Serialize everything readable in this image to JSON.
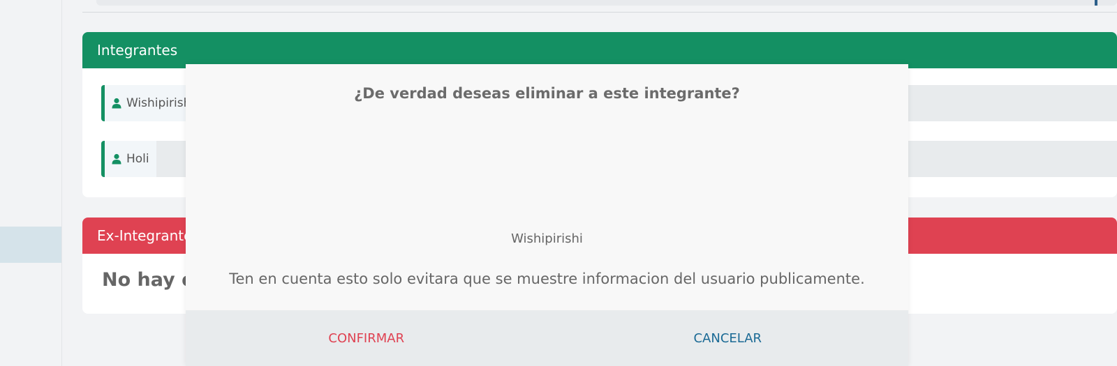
{
  "sections": {
    "integrantes": {
      "title": "Integrantes",
      "members": [
        {
          "name": "Wishipirishi"
        },
        {
          "name": "Holi"
        }
      ]
    },
    "ex_integrantes": {
      "title": "Ex-Integrantes",
      "empty_text": "No hay ex-integrantes"
    }
  },
  "modal": {
    "title": "¿De verdad deseas eliminar a este integrante?",
    "member_name": "Wishipirishi",
    "note": "Ten en cuenta esto solo evitara que se muestre informacion del usuario publicamente.",
    "confirm_label": "CONFIRMAR",
    "cancel_label": "CANCELAR"
  },
  "colors": {
    "integrantes_header": "#149063",
    "ex_integrantes_header": "#df4252",
    "confirm": "#df4252",
    "cancel": "#1b6a95"
  },
  "icons": {
    "member": "user-icon"
  }
}
